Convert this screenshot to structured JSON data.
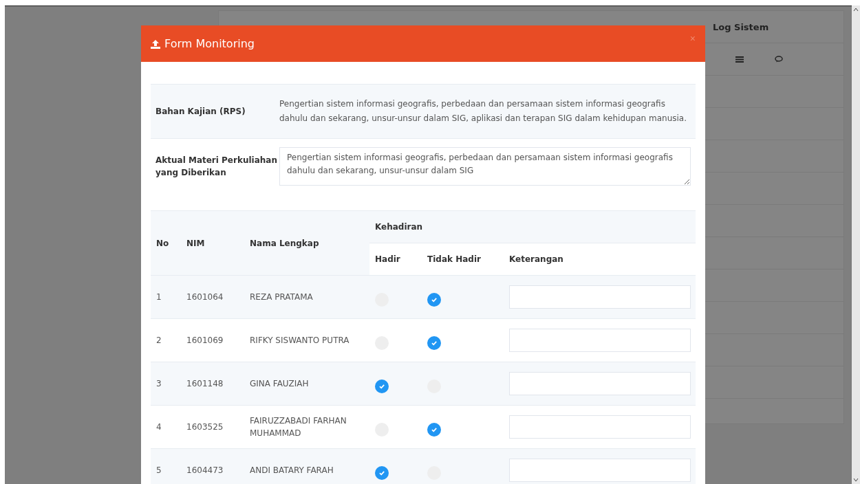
{
  "background_page": {
    "column_header": "Log Sistem"
  },
  "modal": {
    "title": "Form Monitoring",
    "close": "×",
    "fields": [
      {
        "kind": "text",
        "label": "Bahan Kajian (RPS)",
        "value": "Pengertian sistem informasi geografis, perbedaan dan persamaan sistem informasi geografis dahulu dan sekarang, unsur-unsur dalam SIG, aplikasi dan terapan SIG dalam kehidupan manusia."
      },
      {
        "kind": "textarea",
        "label": "Aktual Materi Perkuliahan yang Diberikan",
        "value": "Pengertian sistem informasi geografis, perbedaan dan persamaan sistem informasi geografis dahulu dan sekarang, unsur-unsur dalam SIG"
      }
    ],
    "table": {
      "columns": {
        "no": "No",
        "nim": "NIM",
        "name": "Nama Lengkap",
        "group": "Kehadiran",
        "present": "Hadir",
        "absent": "Tidak Hadir",
        "note": "Keterangan"
      },
      "rows": [
        {
          "no": "1",
          "nim": "1601064",
          "name": "REZA PRATAMA",
          "present": false,
          "absent": true
        },
        {
          "no": "2",
          "nim": "1601069",
          "name": "RIFKY SISWANTO PUTRA",
          "present": false,
          "absent": true
        },
        {
          "no": "3",
          "nim": "1601148",
          "name": "GINA FAUZIAH",
          "present": true,
          "absent": false
        },
        {
          "no": "4",
          "nim": "1603525",
          "name": "FAIRUZZABADI FARHAN MUHAMMAD",
          "present": false,
          "absent": true
        },
        {
          "no": "5",
          "nim": "1604473",
          "name": "ANDI BATARY FARAH",
          "present": true,
          "absent": false
        }
      ]
    }
  }
}
